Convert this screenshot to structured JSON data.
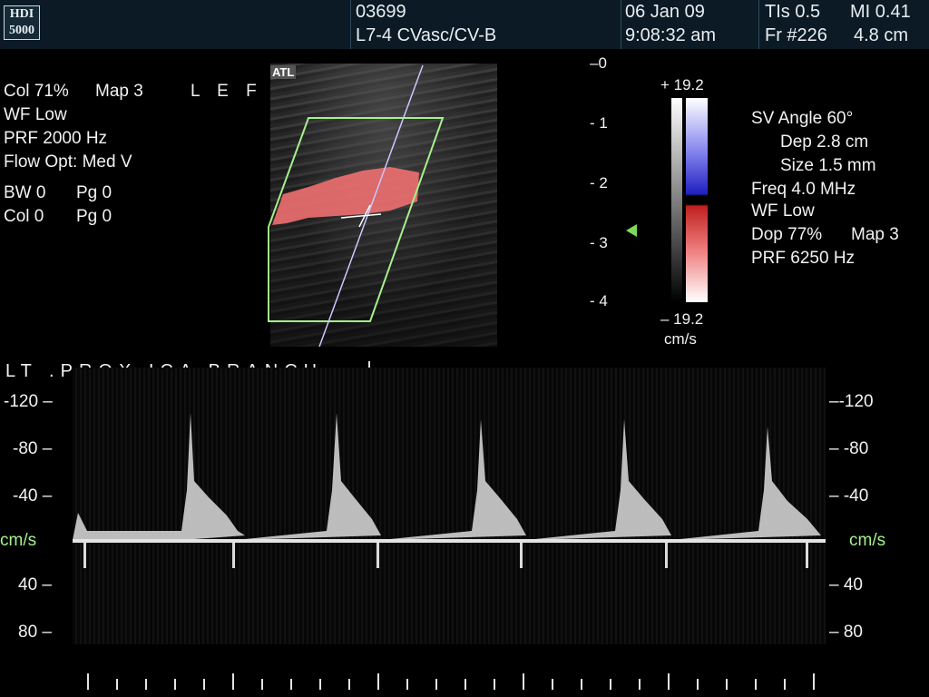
{
  "header": {
    "logo": "HDI 5000",
    "patient_id": "03699",
    "probe": "L7-4 CVasc/CV-B",
    "date": "06 Jan 09",
    "time": "9:08:32 am",
    "tis": "TIs 0.5",
    "mi": "MI 0.41",
    "frame": "Fr #226",
    "depth": "4.8 cm"
  },
  "left_panel": {
    "col": "Col 71%",
    "map": "Map 3",
    "side": "L E F T",
    "wf": "WF Low",
    "prf": "PRF 2000  Hz",
    "flow_opt": "Flow Opt: Med V",
    "bw": "BW 0",
    "pg1": "Pg 0",
    "col0": "Col 0",
    "pg2": "Pg 0"
  },
  "image": {
    "atl": "ATL",
    "depth_ticks": [
      "0",
      "1",
      "2",
      "3",
      "4"
    ]
  },
  "colorbar": {
    "top": "+ 19.2",
    "bottom": "– 19.2",
    "unit": "cm/s"
  },
  "right_panel": {
    "sv_angle": "SV Angle 60°",
    "dep": "Dep 2.8  cm",
    "size": "Size 1.5  mm",
    "freq": "Freq 4.0  MHz",
    "wf": "WF Low",
    "dop": "Dop 77%",
    "map": "Map 3",
    "prf": "PRF 6250  Hz"
  },
  "spectrum": {
    "label": "LT  .PROX  ICA  BRANCH",
    "unit": "cm/s",
    "left_scale": [
      "-120",
      "-80",
      "-40",
      "40",
      "80"
    ],
    "right_scale": [
      "-120",
      "-80",
      "-40",
      "40",
      "80"
    ]
  },
  "colors": {
    "header_bg": "#0b1a24",
    "doppler_red": "#f07070",
    "doppler_blue": "#2020c0",
    "outline": "#a6f08a"
  }
}
